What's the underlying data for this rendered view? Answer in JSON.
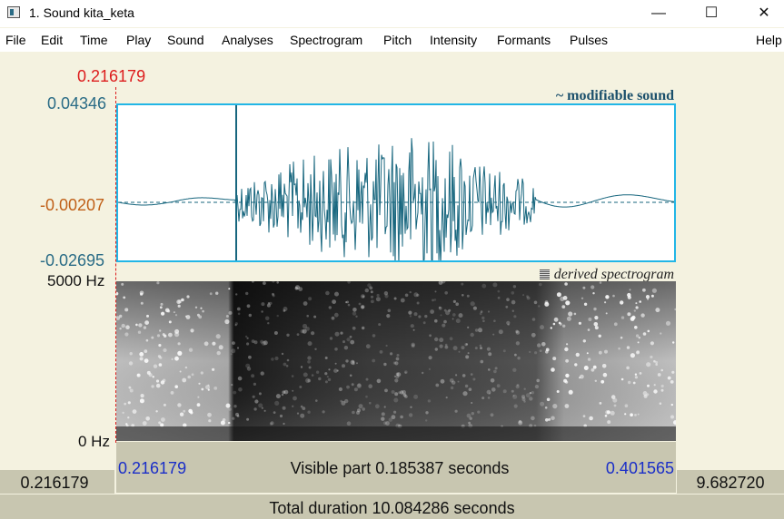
{
  "window": {
    "title": "1. Sound kita_keta",
    "minimize_icon": "minimize-icon",
    "maximize_icon": "maximize-icon",
    "close_icon": "close-icon"
  },
  "menu": [
    "File",
    "Edit",
    "Time",
    "Play",
    "Sound",
    "Analyses",
    "Spectrogram",
    "Pitch",
    "Intensity",
    "Formants",
    "Pulses",
    "Help"
  ],
  "cursor": {
    "time": "0.216179"
  },
  "waveform": {
    "title": "~ modifiable sound",
    "top_value": "0.04346",
    "mid_value": "-0.00207",
    "bottom_value": "-0.02695",
    "color": "#17667e",
    "border_color": "#22b6e6"
  },
  "spectrogram": {
    "title": "derived spectrogram",
    "top_label": "5000 Hz",
    "bottom_label": "0 Hz"
  },
  "selection": {
    "start": "0.216179",
    "visible_text": "Visible part 0.185387 seconds",
    "end": "0.401565"
  },
  "window_start": "0.216179",
  "window_end": "9.682720",
  "total_text": "Total duration 10.084286 seconds"
}
